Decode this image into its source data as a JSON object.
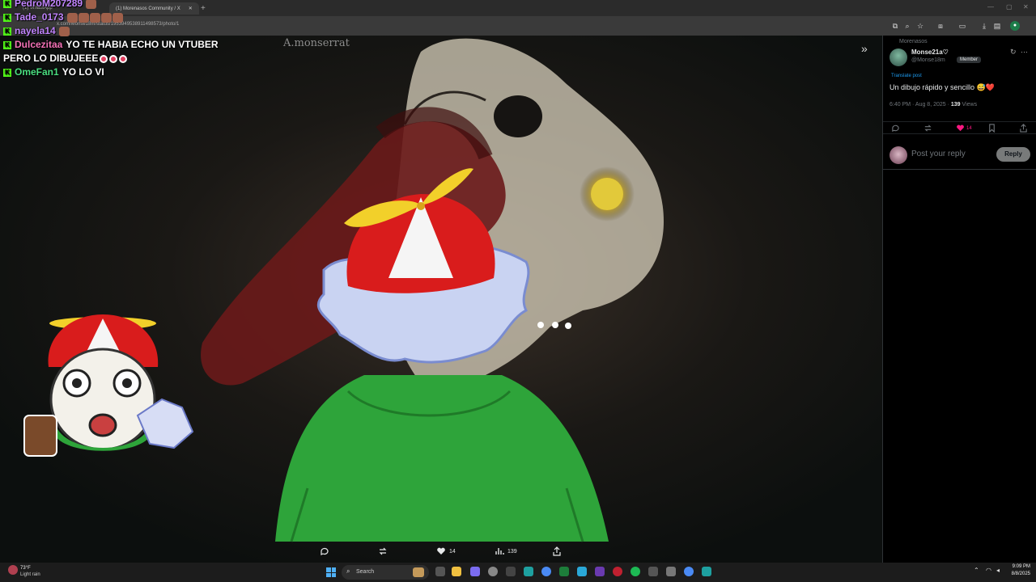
{
  "browser": {
    "tabs": [
      {
        "title": "(1) WhatsApp",
        "active": false
      },
      {
        "title": "(1) Morenasos Community / X",
        "active": true
      }
    ],
    "url": "x.com/Monse18m/status/1953949538911498573/photo/1",
    "new_tab_label": "+"
  },
  "chat": [
    {
      "user": "PedroM207289",
      "text": "",
      "user_color": "#c084fc"
    },
    {
      "user": "Tade_0173",
      "text": "",
      "user_color": "#c084fc"
    },
    {
      "user": "nayela14",
      "text": "",
      "user_color": "#c084fc"
    },
    {
      "user": "Dulcezitaa",
      "text": "YO TE HABIA ECHO UN VTUBER",
      "user_color": "#f472b6"
    },
    {
      "user": "",
      "text": "PERO LO DIBUJEEE",
      "user_color": "#f472b6"
    },
    {
      "user": "OmeFan1",
      "text": "YO LO VI",
      "user_color": "#4ade80"
    }
  ],
  "viewer": {
    "watermark": "A.monserrat",
    "actions": {
      "likes": "14",
      "views": "139"
    }
  },
  "post": {
    "community": "Morenasos",
    "author_name": "Monse21a♡",
    "author_handle": "@Monse18m",
    "badge": "Member",
    "translate": "Translate post",
    "text": "Un dibujo rápido y sencillo 😅❤️",
    "time": "6:40 PM · Aug 8, 2025 · ",
    "views_count": "139",
    "views_label": " Views",
    "likes": "14",
    "reply_placeholder": "Post your reply",
    "reply_button": "Reply"
  },
  "taskbar": {
    "weather_temp": "73°F",
    "weather_desc": "Light rain",
    "search_label": "Search",
    "time": "9:09 PM",
    "date": "8/8/2025"
  },
  "colors": {
    "kick_green": "#53fc18",
    "like_pink": "#f91880",
    "twitter_blue": "#1d9bf0"
  }
}
